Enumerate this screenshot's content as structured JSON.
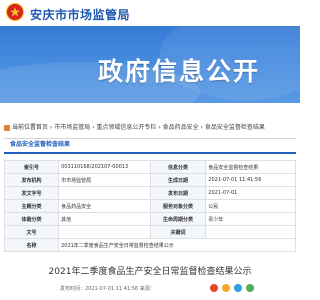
{
  "site": {
    "name": "安庆市市场监管局"
  },
  "header": {
    "title": "政府信息公开"
  },
  "breadcrumb": {
    "label": "当前位置：",
    "path": "首页 › 市市场监管局 › 重点领域信息公开专栏 › 食品药品安全 › 食品安全监督检查结果"
  },
  "section": {
    "title": "食品安全监督检查结果"
  },
  "table": {
    "rows": [
      {
        "k1": "索引号",
        "v1": "003110168/202107-00013",
        "k2": "信息分类",
        "v2": "食品安全监督检查结果"
      },
      {
        "k1": "发布机构",
        "v1": "市市场监管局",
        "k2": "生成日期",
        "v2": "2021-07-01 11:41:56"
      },
      {
        "k1": "发文字号",
        "v1": "",
        "k2": "发布日期",
        "v2": "2021-07-01"
      },
      {
        "k1": "主题分类",
        "v1": "食品药品安全",
        "k2": "服务对象分类",
        "v2": "公民"
      },
      {
        "k1": "体裁分类",
        "v1": "其他",
        "k2": "生命周期分类",
        "v2": "青少年"
      },
      {
        "k1": "文号",
        "v1": "",
        "k2": "关键词",
        "v2": ""
      },
      {
        "k1": "名称",
        "v1": "2021年二季度食品生产安全日常监督检查结果公示",
        "k2": "",
        "v2": ""
      }
    ]
  },
  "doc": {
    "title": "2021年二季度食品生产安全日常监督检查结果公示",
    "meta": "发布时间：2021-07-01 11:41:56   来源：",
    "share_colors": [
      "#e8452c",
      "#f5a623",
      "#2aa2e0",
      "#4caf50"
    ]
  },
  "colors": {
    "brand": "#1d5fbb",
    "header_top": "#2b6cc7",
    "header_bottom": "#5a9ae4"
  }
}
